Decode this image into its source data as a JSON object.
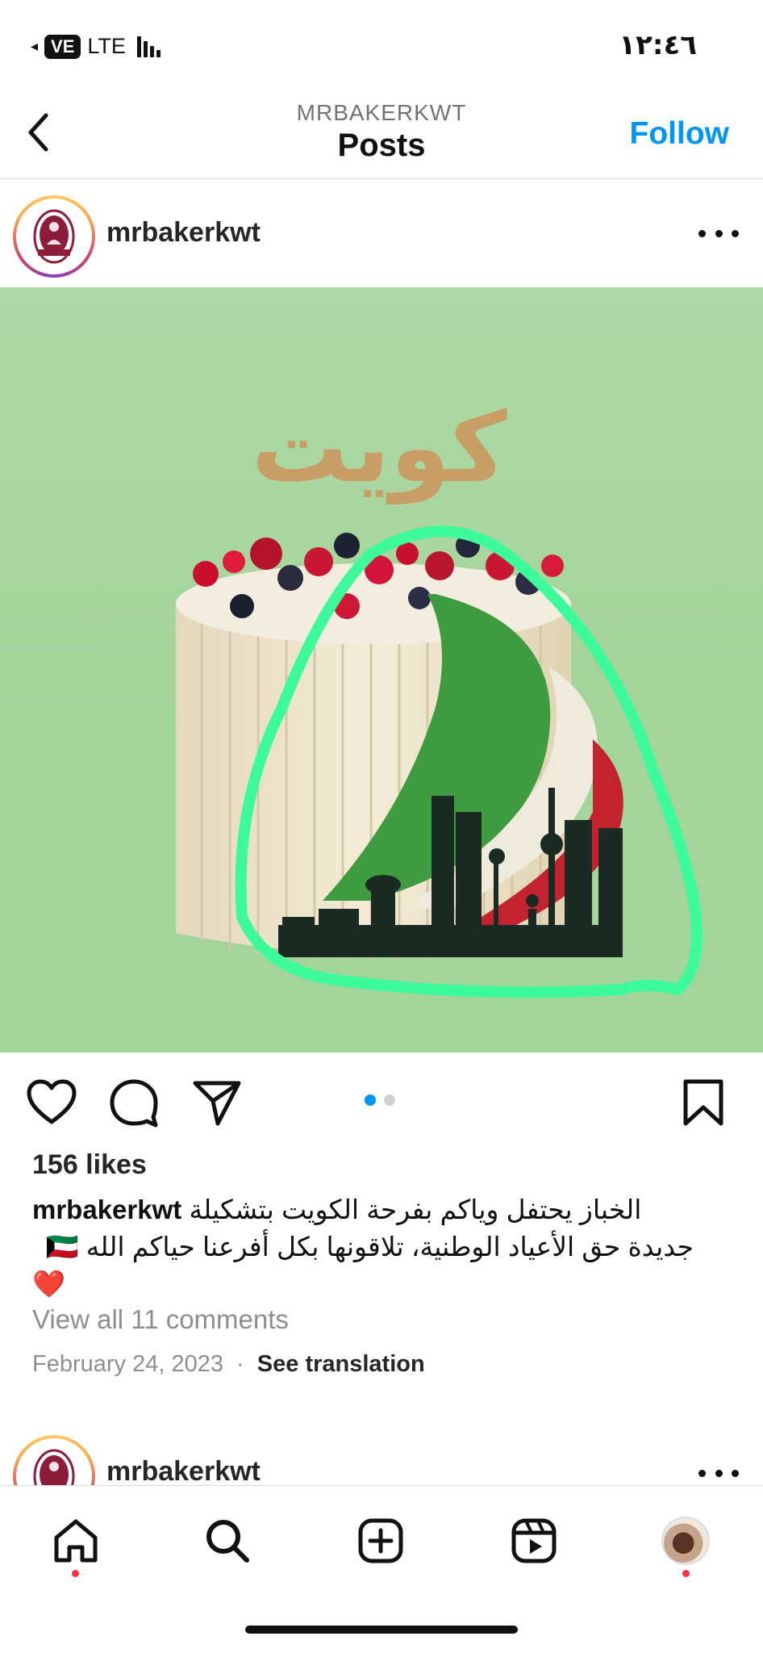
{
  "status_bar": {
    "network_badge": "VE",
    "network_type": "LTE",
    "time": "١٢:٤٦"
  },
  "header": {
    "account": "MRBAKERKWT",
    "title": "Posts",
    "follow_label": "Follow",
    "follow_color": "#0095f6"
  },
  "post": {
    "username": "mrbakerkwt",
    "image_topper_text": "كويت",
    "carousel": {
      "current": 1,
      "total": 2
    },
    "likes": "156 likes",
    "caption": {
      "username": "mrbakerkwt",
      "line1": "الخباز يحتفل وياكم بفرحة الكويت بتشكيلة",
      "line2": "جديدة حق الأعياد الوطنية، تلاقونها بكل أفرعنا حياكم الله",
      "flag_emoji": "🇰🇼",
      "heart_emoji": "❤️"
    },
    "view_comments": "View all 11 comments",
    "date": "February 24, 2023",
    "separator": "·",
    "see_translation": "See translation"
  },
  "next_post": {
    "username": "mrbakerkwt"
  },
  "icons": {
    "back": "chevron-left-icon",
    "more": "more-horizontal-icon",
    "like": "heart-icon",
    "comment": "comment-icon",
    "share": "send-icon",
    "save": "bookmark-icon",
    "home": "home-icon",
    "search": "search-icon",
    "create": "plus-square-icon",
    "reels": "reels-icon"
  },
  "colors": {
    "accent_blue": "#0095f6",
    "notification_red": "#ff3040",
    "highlight_green": "#3dfb9a"
  }
}
